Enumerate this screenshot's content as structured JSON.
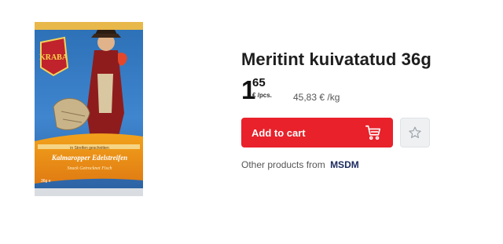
{
  "product": {
    "title": "Meritint kuivatatud 36g",
    "image": {
      "brand_text": "KRABA",
      "flavor_text": "Kalmaropper Edelstreifen",
      "subtitle_text": "in Streifen geschnitten",
      "sub_line_text": "Snack Getrocknet Fisch",
      "weight_text": "36g e",
      "alt_icon": "dried-squid-package-pirate"
    }
  },
  "price": {
    "integer": "1",
    "cents": "65",
    "unit": "€ /pcs.",
    "per_unit": "45,83 € /kg"
  },
  "actions": {
    "add_to_cart_label": "Add to cart",
    "cart_icon": "cart-icon",
    "favorite_icon": "star-outline-icon"
  },
  "other_products": {
    "prefix": "Other products from",
    "brand": "MSDM"
  },
  "colors": {
    "accent_red": "#e8212a",
    "brand_link": "#1b2a5e",
    "favorite_bg": "#eef0f2"
  }
}
